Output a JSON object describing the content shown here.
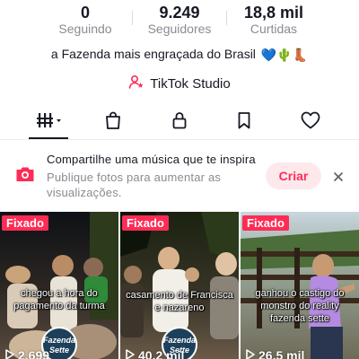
{
  "stats": [
    {
      "value": "0",
      "label": "Seguindo"
    },
    {
      "value": "9.249",
      "label": "Seguidores"
    },
    {
      "value": "18,8 mil",
      "label": "Curtidas"
    }
  ],
  "bio": {
    "text": "a Fazenda mais engraçada do Brasil",
    "emojis": "💙🌵👢"
  },
  "studio": {
    "label": "TikTok Studio"
  },
  "tabs": [
    {
      "icon": "grid-videos-icon",
      "active": true
    },
    {
      "icon": "shop-bag-icon",
      "active": false
    },
    {
      "icon": "lock-icon",
      "active": false
    },
    {
      "icon": "bookmark-icon",
      "active": false
    },
    {
      "icon": "heart-icon",
      "active": false
    }
  ],
  "promo": {
    "title": "Compartilhe uma música que te inspira",
    "subtitle": "Publique fotos para aumentar as visualizações.",
    "button": "Criar"
  },
  "videos": [
    {
      "pinned": "Fixado",
      "caption": "chegou a hora do pagamento da turma",
      "views": "2.699",
      "logo_line1": "Fazenda",
      "logo_line2": "Sette"
    },
    {
      "pinned": "Fixado",
      "caption": "casamento de Francisca e nazareno",
      "views": "40,2 mil",
      "logo_line1": "Fazenda",
      "logo_line2": "Sette"
    },
    {
      "pinned": "Fixado",
      "caption": "ganhou o castigo do monstro do reality fazenda sette",
      "views": "26,5 mil"
    }
  ],
  "colors": {
    "accent": "#fe2c55",
    "text": "#161823",
    "muted": "#8a8b91"
  }
}
